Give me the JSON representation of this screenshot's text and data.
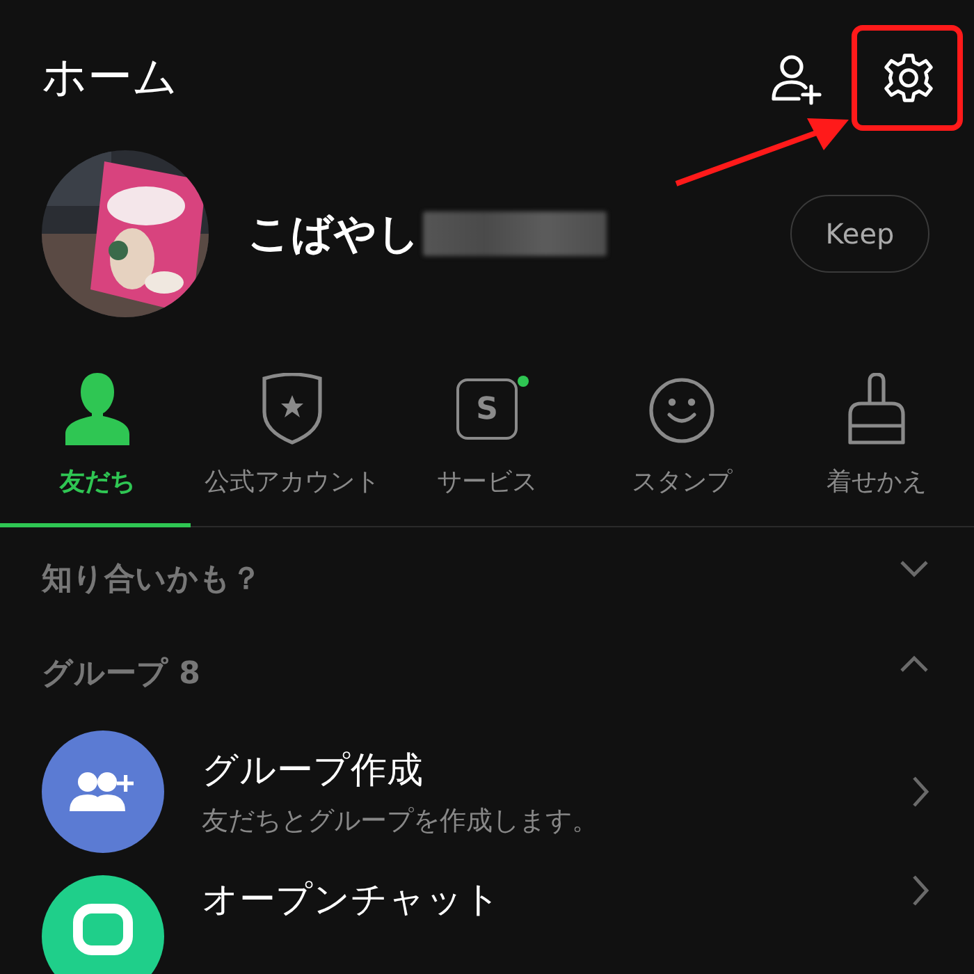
{
  "header": {
    "title": "ホーム"
  },
  "profile": {
    "name": "こばやし",
    "name_redacted": true,
    "keep_button": "Keep"
  },
  "tabs": [
    {
      "label": "友だち",
      "kind": "person",
      "selected": true,
      "badge": false
    },
    {
      "label": "公式アカウント",
      "kind": "shield",
      "selected": false,
      "badge": false
    },
    {
      "label": "サービス",
      "kind": "service",
      "icon_text": "S",
      "selected": false,
      "badge": true
    },
    {
      "label": "スタンプ",
      "kind": "smiley",
      "selected": false,
      "badge": false
    },
    {
      "label": "着せかえ",
      "kind": "brush",
      "selected": false,
      "badge": false
    }
  ],
  "sections": [
    {
      "title": "知り合いかも？",
      "expanded": false
    },
    {
      "title": "グループ 8",
      "expanded": true,
      "items": [
        {
          "title": "グループ作成",
          "subtitle": "友だちとグループを作成します。",
          "kind": "group-add"
        },
        {
          "title": "オープンチャット",
          "kind": "open-chat"
        }
      ]
    }
  ],
  "annotation": {
    "visible": true
  }
}
